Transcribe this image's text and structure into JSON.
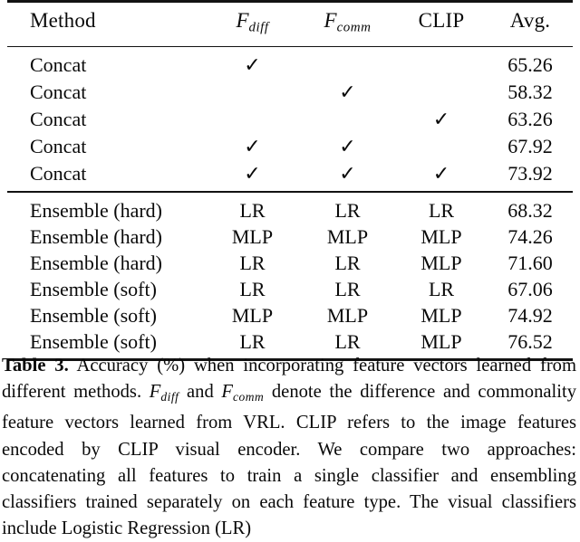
{
  "table": {
    "columns": [
      {
        "key": "method",
        "label": "Method",
        "style": "bold",
        "align": "left"
      },
      {
        "key": "f_diff",
        "label": "F_diff",
        "base": "F",
        "sub": "diff",
        "style": "math",
        "align": "center"
      },
      {
        "key": "f_comm",
        "label": "F_comm",
        "base": "F",
        "sub": "comm",
        "style": "math",
        "align": "center"
      },
      {
        "key": "clip",
        "label": "CLIP",
        "style": "bold",
        "align": "center"
      },
      {
        "key": "avg",
        "label": "Avg.",
        "style": "bold",
        "align": "center"
      }
    ],
    "check_glyph": "✓",
    "groups": [
      {
        "name": "concat-group",
        "rows": [
          {
            "method": "Concat",
            "f_diff": "✓",
            "f_comm": "",
            "clip": "",
            "avg": "65.26",
            "bold_avg": false
          },
          {
            "method": "Concat",
            "f_diff": "",
            "f_comm": "✓",
            "clip": "",
            "avg": "58.32",
            "bold_avg": false
          },
          {
            "method": "Concat",
            "f_diff": "",
            "f_comm": "",
            "clip": "✓",
            "avg": "63.26",
            "bold_avg": false
          },
          {
            "method": "Concat",
            "f_diff": "✓",
            "f_comm": "✓",
            "clip": "",
            "avg": "67.92",
            "bold_avg": false
          },
          {
            "method": "Concat",
            "f_diff": "✓",
            "f_comm": "✓",
            "clip": "✓",
            "avg": "73.92",
            "bold_avg": false
          }
        ]
      },
      {
        "name": "ensemble-group",
        "rows": [
          {
            "method": "Ensemble (hard)",
            "f_diff": "LR",
            "f_comm": "LR",
            "clip": "LR",
            "avg": "68.32",
            "bold_avg": false
          },
          {
            "method": "Ensemble (hard)",
            "f_diff": "MLP",
            "f_comm": "MLP",
            "clip": "MLP",
            "avg": "74.26",
            "bold_avg": false
          },
          {
            "method": "Ensemble (hard)",
            "f_diff": "LR",
            "f_comm": "LR",
            "clip": "MLP",
            "avg": "71.60",
            "bold_avg": false
          },
          {
            "method": "Ensemble (soft)",
            "f_diff": "LR",
            "f_comm": "LR",
            "clip": "LR",
            "avg": "67.06",
            "bold_avg": false
          },
          {
            "method": "Ensemble (soft)",
            "f_diff": "MLP",
            "f_comm": "MLP",
            "clip": "MLP",
            "avg": "74.92",
            "bold_avg": false
          },
          {
            "method": "Ensemble (soft)",
            "f_diff": "LR",
            "f_comm": "LR",
            "clip": "MLP",
            "avg": "76.52",
            "bold_avg": true
          }
        ]
      }
    ]
  },
  "caption": {
    "label": "Table 3.",
    "part1": " Accuracy (%) when incorporating feature vectors learned from different methods. ",
    "math1_base": "F",
    "math1_sub": "diff",
    "part2": " and ",
    "math2_base": "F",
    "math2_sub": "comm",
    "part3": " denote the difference and commonality feature vectors learned from VRL. CLIP refers to the image features encoded by CLIP visual encoder. We compare two approaches: concatenating all features to train a single classifier and ensembling classifiers trained separately on each feature type. The visual classifiers include Logistic Regression (LR)"
  }
}
